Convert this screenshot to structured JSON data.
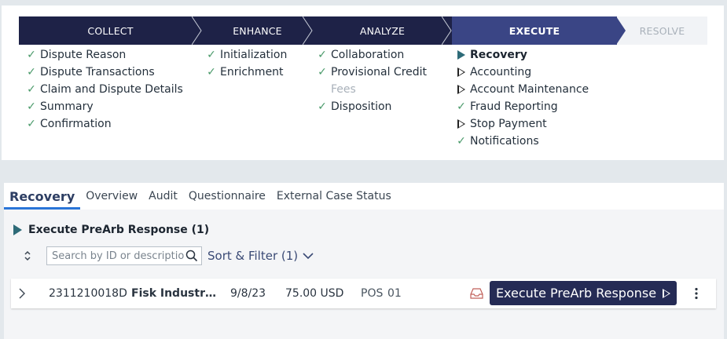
{
  "stages": [
    {
      "label": "COLLECT",
      "state": "done"
    },
    {
      "label": "ENHANCE",
      "state": "done"
    },
    {
      "label": "ANALYZE",
      "state": "done"
    },
    {
      "label": "EXECUTE",
      "state": "current"
    },
    {
      "label": "RESOLVE",
      "state": "future"
    }
  ],
  "steps": {
    "collect": [
      "Dispute Reason",
      "Dispute Transactions",
      "Claim and Dispute Details",
      "Summary",
      "Confirmation"
    ],
    "enhance": [
      "Initialization",
      "Enrichment"
    ],
    "analyze": {
      "collaboration": "Collaboration",
      "provisional_credit": "Provisional Credit",
      "fees": "Fees",
      "disposition": "Disposition"
    },
    "execute": {
      "recovery": "Recovery",
      "accounting": "Accounting",
      "account_maintenance": "Account Maintenance",
      "fraud_reporting": "Fraud Reporting",
      "stop_payment": "Stop Payment",
      "notifications": "Notifications"
    }
  },
  "tabs": [
    "Recovery",
    "Overview",
    "Audit",
    "Questionnaire",
    "External Case Status"
  ],
  "section": {
    "title": "Execute PreArb Response (1)"
  },
  "search": {
    "placeholder": "Search by ID or description"
  },
  "filter": {
    "label": "Sort & Filter (1)"
  },
  "row": {
    "id": "2311210018D",
    "name": "Fisk Industr…",
    "date": "9/8/23",
    "amount": "75.00 USD",
    "type": "POS",
    "code": "01",
    "action_label": "Execute PreArb Response"
  },
  "colors": {
    "stage_done": "#1e2247",
    "stage_current": "#3a4585",
    "check": "#4a9a6a",
    "action": "#252b55",
    "tab_underline": "#2a75d8"
  }
}
